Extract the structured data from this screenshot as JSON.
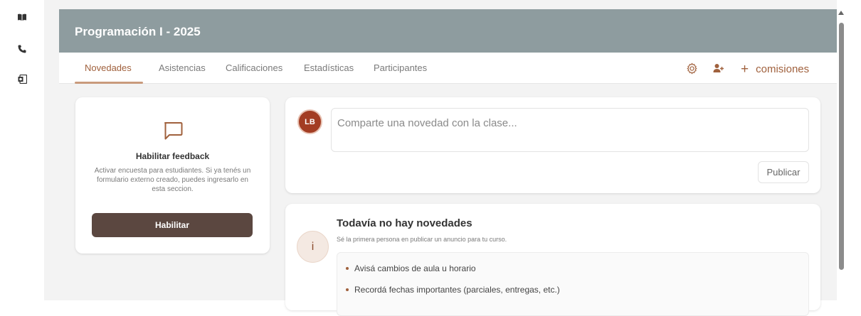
{
  "rail": {
    "icons": [
      "book-icon",
      "phone-icon",
      "outlook-icon"
    ]
  },
  "header": {
    "title": "Programación I - 2025"
  },
  "tabs": [
    {
      "label": "Novedades",
      "active": true
    },
    {
      "label": "Asistencias",
      "active": false
    },
    {
      "label": "Calificaciones",
      "active": false
    },
    {
      "label": "Estadísticas",
      "active": false
    },
    {
      "label": "Participantes",
      "active": false
    }
  ],
  "toolbar": {
    "settings_icon": "gear-icon",
    "add_user_icon": "add-user-icon",
    "comisiones_label": "comisiones"
  },
  "feedback": {
    "title": "Habilitar feedback",
    "description": "Activar encuesta para estudiantes. Si ya tenés un formulario externo creado, puedes ingresarlo en esta seccion.",
    "button_label": "Habilitar"
  },
  "compose": {
    "avatar_initials": "LB",
    "placeholder": "Comparte una novedad con la clase...",
    "publish_label": "Publicar"
  },
  "empty_state": {
    "icon_glyph": "i",
    "title": "Todavía no hay novedades",
    "subtitle": "Sé la primera persona en publicar un anuncio para tu curso.",
    "tips": [
      "Avisá cambios de aula u horario",
      "Recordá fechas importantes (parciales, entregas, etc.)"
    ]
  },
  "colors": {
    "header_bg": "#8e9c9f",
    "accent": "#a0613d",
    "button_dark": "#5b4740",
    "avatar_bg": "#a33d23"
  }
}
